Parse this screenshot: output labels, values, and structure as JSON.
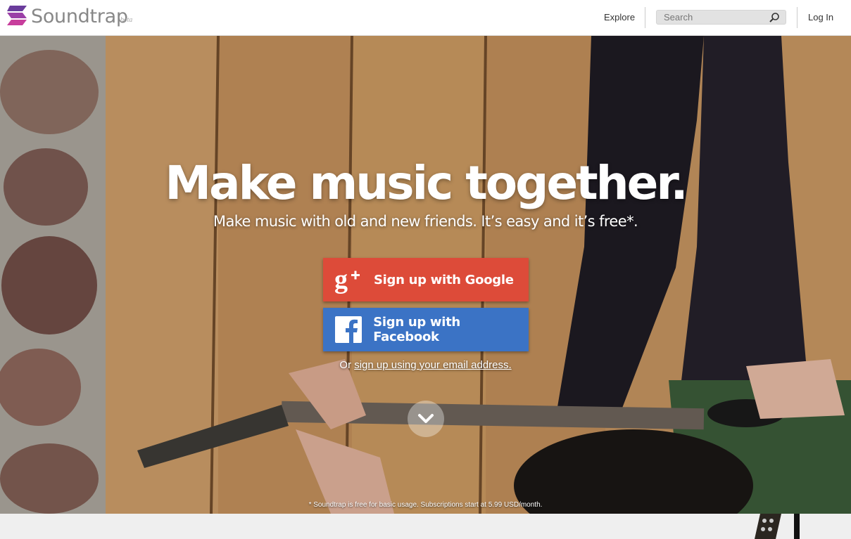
{
  "header": {
    "logo_text": "Soundtrap",
    "logo_badge": "beta",
    "explore_label": "Explore",
    "search_placeholder": "Search",
    "login_label": "Log In"
  },
  "hero": {
    "title": "Make music together.",
    "subtitle": "Make music with old and new friends. It’s easy and it’s free*.",
    "google_button_label": "Sign up with Google",
    "facebook_button_label": "Sign up with Facebook",
    "email_prefix": "Or ",
    "email_link_label": "sign up using your email address.",
    "footnote": "* Soundtrap is free for basic usage. Subscriptions start at 5.99 USD/month."
  },
  "colors": {
    "google": "#dd4b39",
    "facebook": "#3b73c5",
    "logo_purple": "#7a3fa0",
    "logo_pink": "#c0399b"
  },
  "icons": [
    "soundtrap-logo-icon",
    "search-icon",
    "google-plus-icon",
    "facebook-icon",
    "chevron-down-icon"
  ]
}
